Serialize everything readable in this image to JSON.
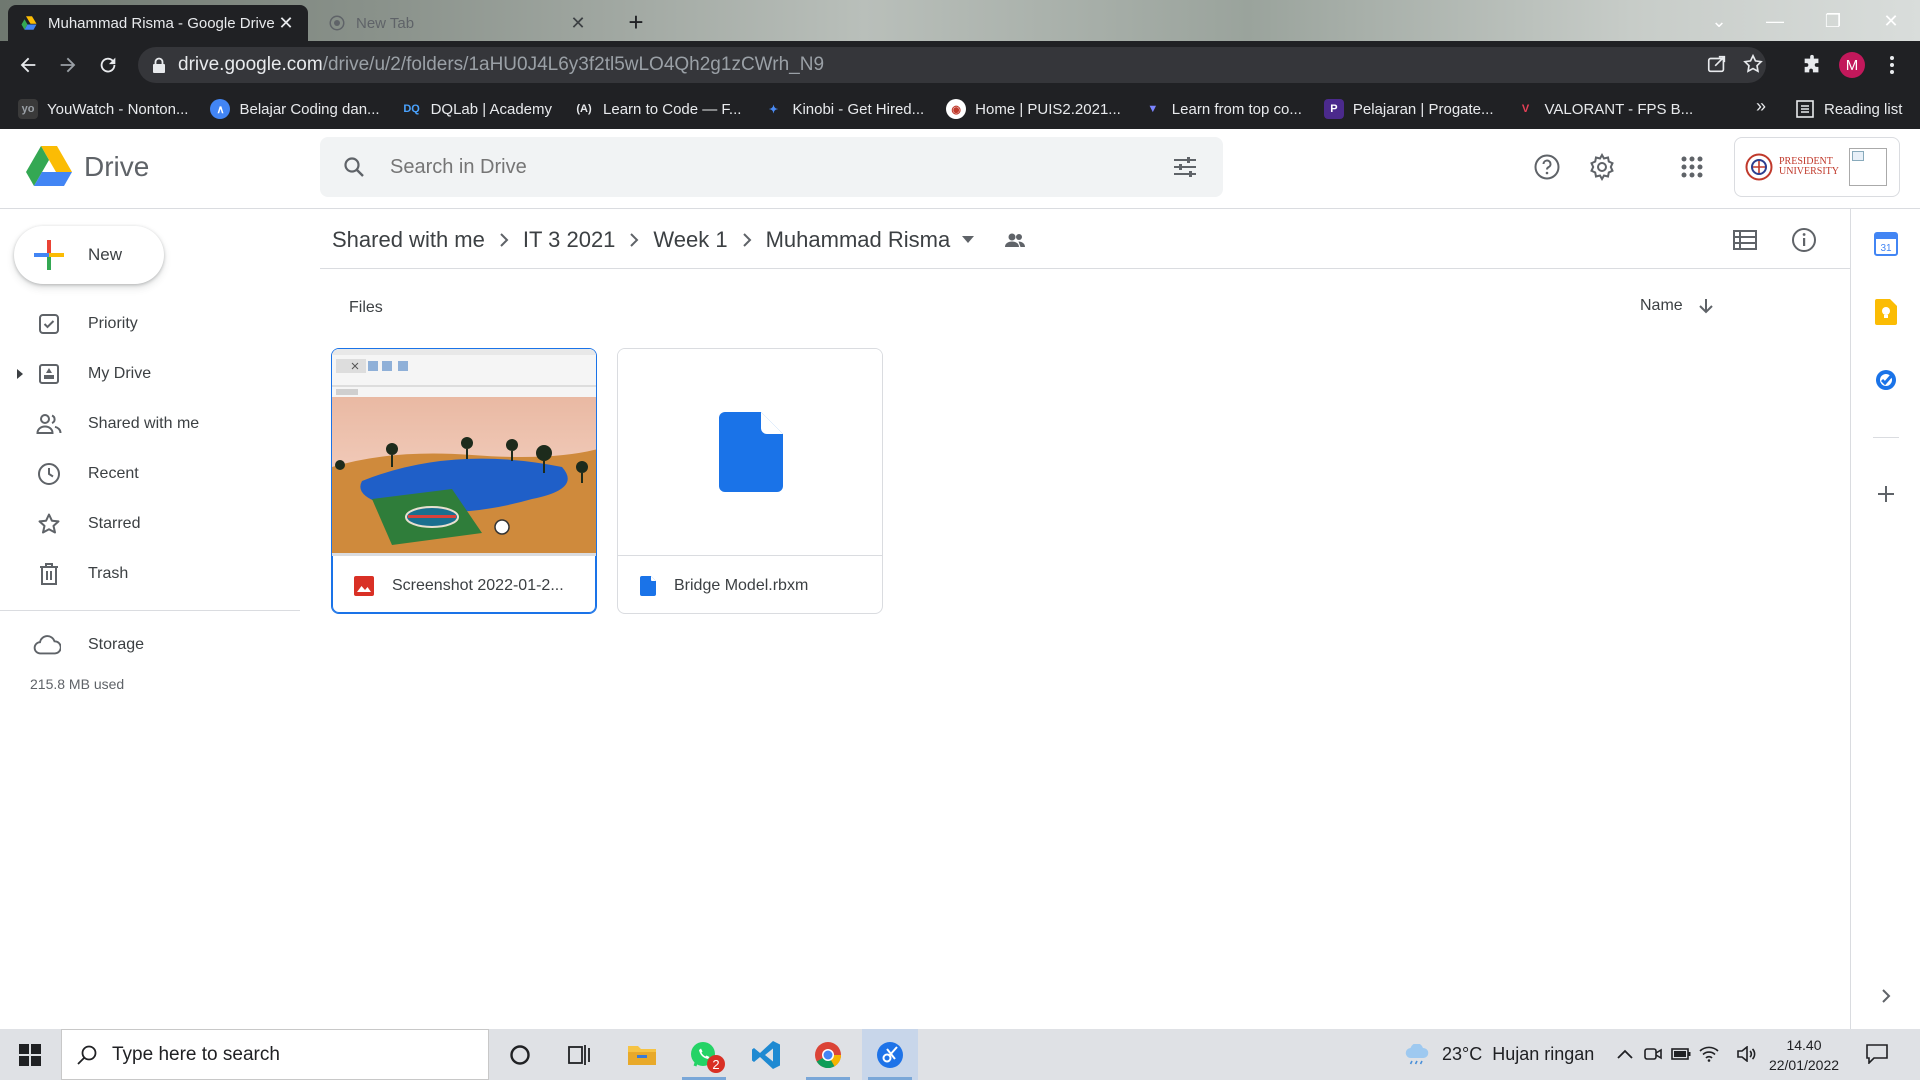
{
  "browser": {
    "tabs": [
      {
        "title": "Muhammad Risma - Google Drive",
        "active": true
      },
      {
        "title": "New Tab",
        "active": false
      }
    ],
    "url_host": "drive.google.com",
    "url_path": "/drive/u/2/folders/1aHU0J4L6y3f2tl5wLO4Qh2g1zCWrh_N9",
    "profile_initial": "M",
    "bookmarks": [
      {
        "label": "YouWatch - Nonton...",
        "icon_text": "yo",
        "color": "#3a3a3a"
      },
      {
        "label": "Belajar Coding dan...",
        "icon_text": "",
        "color": "#4285f4"
      },
      {
        "label": "DQLab | Academy",
        "icon_text": "DQ",
        "color": "#202124"
      },
      {
        "label": "Learn to Code — F...",
        "icon_text": "(A)",
        "color": "#202124"
      },
      {
        "label": "Kinobi - Get Hired...",
        "icon_text": "",
        "color": "#2d6cdf"
      },
      {
        "label": "Home | PUIS2.2021...",
        "icon_text": "",
        "color": "#c0392b"
      },
      {
        "label": "Learn from top co...",
        "icon_text": "",
        "color": "#5b67f1"
      },
      {
        "label": "Pelajaran | Progate...",
        "icon_text": "P",
        "color": "#4b2a8c"
      },
      {
        "label": "VALORANT - FPS B...",
        "icon_text": "",
        "color": "#e84057"
      }
    ],
    "more_bookmarks": "»",
    "reading_list": "Reading list"
  },
  "drive": {
    "logo_text": "Drive",
    "search_placeholder": "Search in Drive",
    "account_org": "PRESIDENT UNIVERSITY",
    "new_label": "New",
    "nav": [
      {
        "label": "Priority",
        "icon": "priority-icon"
      },
      {
        "label": "My Drive",
        "icon": "my-drive-icon"
      },
      {
        "label": "Shared with me",
        "icon": "shared-icon"
      },
      {
        "label": "Recent",
        "icon": "clock-icon"
      },
      {
        "label": "Starred",
        "icon": "star-icon"
      },
      {
        "label": "Trash",
        "icon": "trash-icon"
      },
      {
        "label": "Storage",
        "icon": "cloud-icon"
      }
    ],
    "storage_used": "215.8 MB used",
    "breadcrumb": [
      "Shared with me",
      "IT 3 2021",
      "Week 1",
      "Muhammad Risma"
    ],
    "files_label": "Files",
    "sort_label": "Name",
    "files": [
      {
        "name": "Screenshot 2022-01-2...",
        "type": "image",
        "selected": true
      },
      {
        "name": "Bridge Model.rbxm",
        "type": "file",
        "selected": false
      }
    ]
  },
  "taskbar": {
    "search_placeholder": "Type here to search",
    "whatsapp_badge": "2",
    "weather": "23°C  Hujan ringan",
    "time": "14.40",
    "date": "22/01/2022"
  },
  "colors": {
    "accent": "#1a73e8",
    "chrome_dark": "#202124",
    "file_blue": "#1a73e8",
    "image_red": "#d93025"
  }
}
